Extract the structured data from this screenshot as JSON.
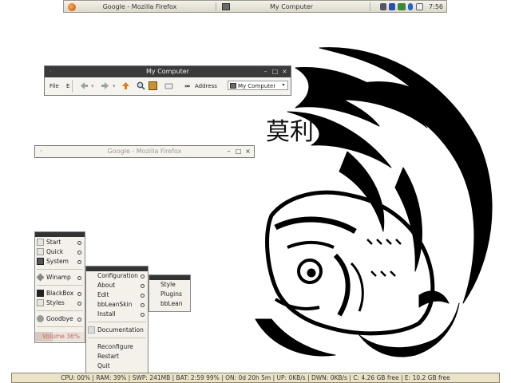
{
  "taskbar": {
    "tasks": [
      {
        "label": "Google - Mozilla Firefox",
        "icon": "firefox-icon"
      },
      {
        "label": "My Computer",
        "icon": "computer-icon"
      }
    ],
    "clock": "7:56",
    "tray_icons": [
      "network-icon",
      "battery-icon",
      "volume-icon",
      "bluetooth-icon",
      "eject-icon"
    ]
  },
  "my_computer_window": {
    "title": "My Computer",
    "menu_file": "File",
    "menu_edit": "E",
    "overflow_1": "»",
    "overflow_2": "»",
    "address_label": "Address",
    "address_value": "My Computer",
    "toolbar_icons": [
      "back-arrow-icon",
      "forward-arrow-icon",
      "up-folder-icon",
      "search-icon",
      "folders-icon",
      "views-icon"
    ]
  },
  "firefox_window": {
    "title": "Google - Mozilla Firefox"
  },
  "main_menu": {
    "items": [
      {
        "label": "Start",
        "icon": "folder-icon"
      },
      {
        "label": "Quick",
        "icon": "folder-icon"
      },
      {
        "label": "System",
        "icon": "computer-icon"
      },
      {
        "label": "Winamp",
        "icon": "winamp-icon"
      },
      {
        "label": "BlackBox",
        "icon": "blackbox-icon"
      },
      {
        "label": "Styles",
        "icon": "folder-icon"
      },
      {
        "label": "Goodbye",
        "icon": "goodbye-icon"
      }
    ],
    "volume_label": "Volume 36%",
    "volume_level": 0.36
  },
  "blackbox_menu": {
    "items": [
      {
        "label": "Configuration"
      },
      {
        "label": "About"
      },
      {
        "label": "Edit"
      },
      {
        "label": "bbLeanSkin"
      },
      {
        "label": "Install"
      },
      {
        "label": "Documentation"
      },
      {
        "label": "Reconfigure"
      },
      {
        "label": "Restart"
      },
      {
        "label": "Quit"
      }
    ]
  },
  "config_menu": {
    "items": [
      {
        "label": "Style"
      },
      {
        "label": "Plugins"
      },
      {
        "label": "bbLean"
      }
    ]
  },
  "wallpaper": {
    "kanji": "莫利"
  },
  "statusbar": {
    "text": "CPU: 00% | RAM: 39% | SWP: 241MB | BAT: 2:59 99% | ON: 0d 20h 5m | UP: 0KB/s | DWN: 0KB/s | C: 4.26 GB free | E: 10.2 GB free"
  },
  "colors": {
    "menu_bg": "#f4f1ea",
    "titlebar_dark": "#3a3a3a",
    "status_bg": "#eae3c8",
    "volume_text": "#c86a6a"
  }
}
